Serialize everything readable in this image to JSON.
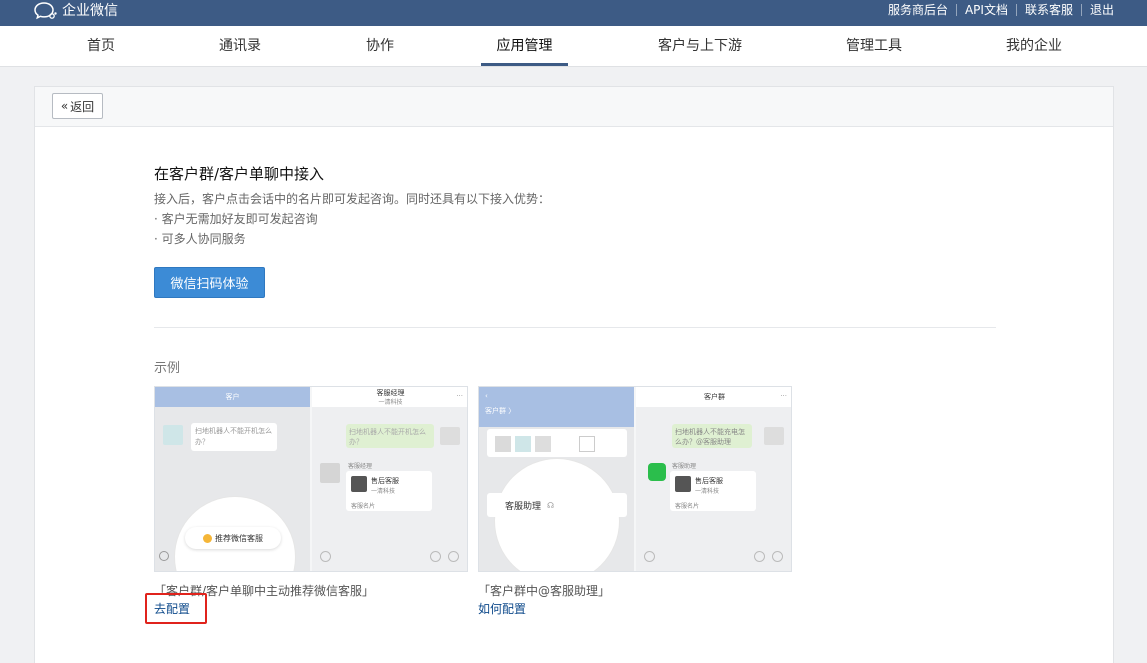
{
  "header": {
    "logo_text": "企业微信",
    "links": [
      "服务商后台",
      "API文档",
      "联系客服",
      "退出"
    ]
  },
  "nav": {
    "tabs": [
      "首页",
      "通讯录",
      "协作",
      "应用管理",
      "客户与上下游",
      "管理工具",
      "我的企业"
    ],
    "active_index": 3
  },
  "page": {
    "back_label": "返回",
    "title": "在客户群/客户单聊中接入",
    "desc_line": "接入后，客户点击会话中的名片即可发起咨询。同时还具有以下接入优势：",
    "bullet_1": "· 客户无需加好友即可发起咨询",
    "bullet_2": "· 可多人协同服务",
    "cta_label": "微信扫码体验",
    "example_label": "示例"
  },
  "examples": [
    {
      "caption": "「客户群/客户单聊中主动推荐微信客服」",
      "link": "去配置",
      "left_header": "客户",
      "left_msg": "扫地机器人不能开机怎么办？",
      "right_header": "客服经理",
      "right_sub": "一清科技",
      "right_msg": "扫地机器人不能开机怎么办？",
      "card_title": "售后客服",
      "card_sub": "一清科技",
      "card_footer": "客服名片",
      "sender_label": "客服经理",
      "highlight": "推荐微信客服"
    },
    {
      "caption": "「客户群中@客服助理」",
      "link": "如何配置",
      "left_header": "客户群 〉",
      "right_header": "客户群",
      "right_msg": "扫地机器人不能充电怎么办？@客服助理",
      "card_title": "售后客服",
      "card_sub": "一清科技",
      "card_footer": "客服名片",
      "sender_label": "客服助理",
      "highlight": "客服助理",
      "left_row_label": "客服助理"
    }
  ],
  "colors": {
    "topbar": "#3d5b85",
    "primary_button": "#3c8bd6",
    "link": "#0e4a8b",
    "highlight_box": "#e0231c"
  }
}
